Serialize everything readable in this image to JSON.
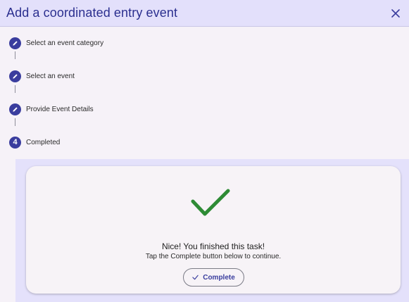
{
  "dialog": {
    "title": "Add a coordinated entry event",
    "close_icon": "close-icon"
  },
  "stepper": {
    "steps": [
      {
        "label": "Select an event category",
        "state": "edit",
        "icon": "pencil-icon"
      },
      {
        "label": "Select an event",
        "state": "edit",
        "icon": "pencil-icon"
      },
      {
        "label": "Provide Event Details",
        "state": "edit",
        "icon": "pencil-icon"
      },
      {
        "label": "Completed",
        "state": "active",
        "number": "4"
      }
    ]
  },
  "completion": {
    "icon": "checkmark-icon",
    "title": "Nice! You finished this task!",
    "subtitle": "Tap the Complete button below to continue.",
    "button_label": "Complete",
    "button_icon": "check-icon"
  },
  "colors": {
    "header_bg": "#e3e0fb",
    "accent": "#3a3d9e",
    "success_green": "#2e8b35",
    "content_bg": "#e4e1fb",
    "surface": "#f6f2f8"
  }
}
